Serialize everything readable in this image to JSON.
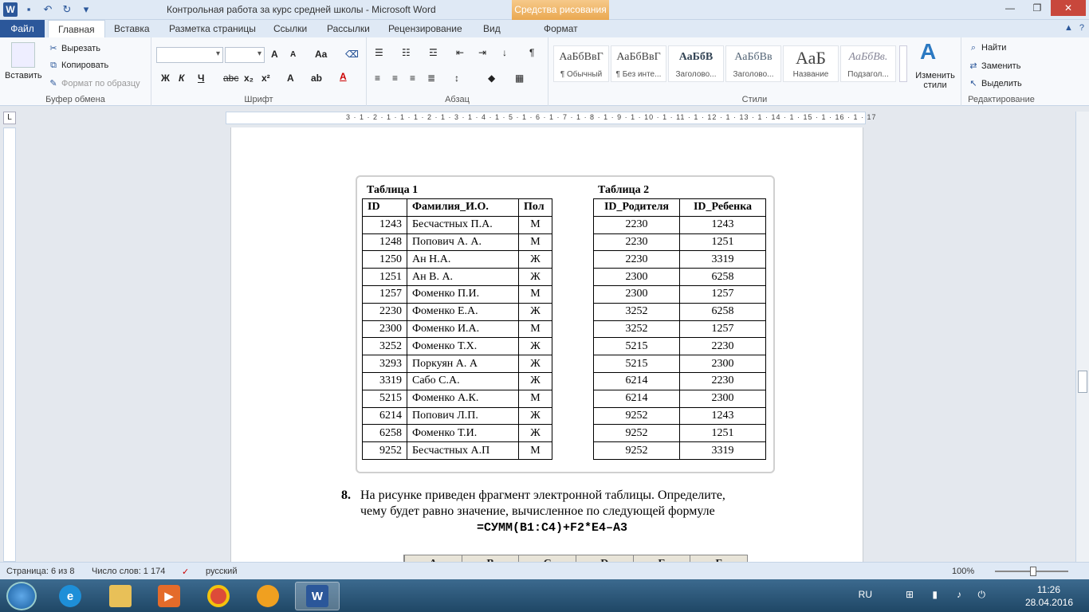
{
  "window": {
    "title": "Контрольная работа за курс средней школы  -  Microsoft Word",
    "context_tab": "Средства рисования",
    "app_icon_letter": "W"
  },
  "tabs": {
    "file": "Файл",
    "items": [
      "Главная",
      "Вставка",
      "Разметка страницы",
      "Ссылки",
      "Рассылки",
      "Рецензирование",
      "Вид",
      "Формат"
    ],
    "active": "Главная"
  },
  "ribbon": {
    "clipboard": {
      "paste": "Вставить",
      "cut": "Вырезать",
      "copy": "Копировать",
      "format_painter": "Формат по образцу",
      "label": "Буфер обмена"
    },
    "font": {
      "label": "Шрифт",
      "grow": "A",
      "shrink": "A",
      "case": "Aa",
      "bold": "Ж",
      "italic": "К",
      "underline": "Ч",
      "strike": "abc",
      "sub": "x₂",
      "sup": "x²"
    },
    "paragraph": {
      "label": "Абзац"
    },
    "styles": {
      "label": "Стили",
      "items": [
        {
          "sample": "АаБбВвГ",
          "name": "¶ Обычный"
        },
        {
          "sample": "АаБбВвГ",
          "name": "¶ Без инте..."
        },
        {
          "sample": "АаБбВ",
          "name": "Заголово..."
        },
        {
          "sample": "АаБбВв",
          "name": "Заголово..."
        },
        {
          "sample": "АаБ",
          "name": "Название"
        },
        {
          "sample": "АаБбВв.",
          "name": "Подзагол..."
        }
      ],
      "change_styles": "Изменить стили"
    },
    "editing": {
      "label": "Редактирование",
      "find": "Найти",
      "replace": "Заменить",
      "select": "Выделить"
    }
  },
  "ruler": {
    "numbers": "3 · 1 · 2 · 1 · 1 · 1 · 2 · 1 · 3 · 1 · 4 · 1 · 5 · 1 · 6 · 1 · 7 · 1 · 8 · 1 · 9 · 1 · 10 · 1 · 11 · 1 · 12 · 1 · 13 · 1 · 14 · 1 · 15 · 1 · 16 · 1 · 17"
  },
  "table1": {
    "caption": "Таблица 1",
    "headers": [
      "ID",
      "Фамилия_И.О.",
      "Пол"
    ],
    "rows": [
      [
        "1243",
        "Бесчастных П.А.",
        "М"
      ],
      [
        "1248",
        "Попович А. А.",
        "М"
      ],
      [
        "1250",
        "Ан Н.А.",
        "Ж"
      ],
      [
        "1251",
        "Ан В. А.",
        "Ж"
      ],
      [
        "1257",
        "Фоменко П.И.",
        "М"
      ],
      [
        "2230",
        "Фоменко Е.А.",
        "Ж"
      ],
      [
        "2300",
        "Фоменко И.А.",
        "М"
      ],
      [
        "3252",
        "Фоменко Т.Х.",
        "Ж"
      ],
      [
        "3293",
        "Поркуян А. А",
        "Ж"
      ],
      [
        "3319",
        "Сабо С.А.",
        "Ж"
      ],
      [
        "5215",
        "Фоменко А.К.",
        "М"
      ],
      [
        "6214",
        "Попович Л.П.",
        "Ж"
      ],
      [
        "6258",
        "Фоменко Т.И.",
        "Ж"
      ],
      [
        "9252",
        "Бесчастных А.П",
        "М"
      ]
    ]
  },
  "table2": {
    "caption": "Таблица 2",
    "headers": [
      "ID_Родителя",
      "ID_Ребенка"
    ],
    "rows": [
      [
        "2230",
        "1243"
      ],
      [
        "2230",
        "1251"
      ],
      [
        "2230",
        "3319"
      ],
      [
        "2300",
        "6258"
      ],
      [
        "2300",
        "1257"
      ],
      [
        "3252",
        "6258"
      ],
      [
        "3252",
        "1257"
      ],
      [
        "5215",
        "2230"
      ],
      [
        "5215",
        "2300"
      ],
      [
        "6214",
        "2230"
      ],
      [
        "6214",
        "2300"
      ],
      [
        "9252",
        "1243"
      ],
      [
        "9252",
        "1251"
      ],
      [
        "9252",
        "3319"
      ]
    ]
  },
  "question8": {
    "number": "8.",
    "line1": "На рисунке приведен фрагмент электронной таблицы. Определите,",
    "line2": "чему будет равно значение, вычисленное по следующей формуле",
    "formula": "=СУММ(B1:C4)+F2*E4–A3",
    "sheet_columns": [
      "A",
      "B",
      "C",
      "D",
      "E",
      "F"
    ]
  },
  "statusbar": {
    "page": "Страница: 6 из 8",
    "words": "Число слов: 1 174",
    "language": "русский",
    "zoom": "100%",
    "zoom_level": 0.5
  },
  "taskbar": {
    "lang": "RU",
    "time": "11:26",
    "date": "28.04.2016"
  },
  "colors": {
    "word_blue": "#2b579a",
    "context_orange": "#eaa850",
    "close_red": "#c8473c"
  }
}
